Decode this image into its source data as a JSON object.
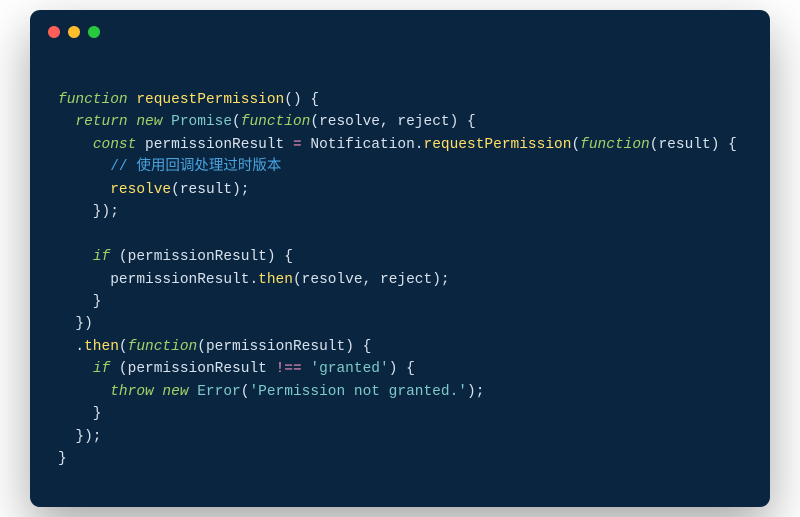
{
  "window": {
    "controls": [
      "close",
      "minimize",
      "zoom"
    ]
  },
  "code": {
    "tokens": [
      [
        {
          "t": "",
          "c": "pn"
        }
      ],
      [
        {
          "t": "function ",
          "c": "kw"
        },
        {
          "t": "requestPermission",
          "c": "fn"
        },
        {
          "t": "() {",
          "c": "pn"
        }
      ],
      [
        {
          "t": "  ",
          "c": "pn"
        },
        {
          "t": "return new ",
          "c": "kw"
        },
        {
          "t": "Promise",
          "c": "cls"
        },
        {
          "t": "(",
          "c": "pn"
        },
        {
          "t": "function",
          "c": "kw"
        },
        {
          "t": "(",
          "c": "pn"
        },
        {
          "t": "resolve",
          "c": "id"
        },
        {
          "t": ", ",
          "c": "pn"
        },
        {
          "t": "reject",
          "c": "id"
        },
        {
          "t": ") {",
          "c": "pn"
        }
      ],
      [
        {
          "t": "    ",
          "c": "pn"
        },
        {
          "t": "const ",
          "c": "kw"
        },
        {
          "t": "permissionResult",
          "c": "id"
        },
        {
          "t": " ",
          "c": "pn"
        },
        {
          "t": "=",
          "c": "op"
        },
        {
          "t": " Notification.",
          "c": "id"
        },
        {
          "t": "requestPermission",
          "c": "fn"
        },
        {
          "t": "(",
          "c": "pn"
        },
        {
          "t": "function",
          "c": "kw"
        },
        {
          "t": "(",
          "c": "pn"
        },
        {
          "t": "result",
          "c": "id"
        },
        {
          "t": ") {",
          "c": "pn"
        }
      ],
      [
        {
          "t": "      ",
          "c": "pn"
        },
        {
          "t": "// 使用回调处理过时版本",
          "c": "cmt"
        }
      ],
      [
        {
          "t": "      ",
          "c": "pn"
        },
        {
          "t": "resolve",
          "c": "fn"
        },
        {
          "t": "(",
          "c": "pn"
        },
        {
          "t": "result",
          "c": "id"
        },
        {
          "t": ");",
          "c": "pn"
        }
      ],
      [
        {
          "t": "    });",
          "c": "pn"
        }
      ],
      [
        {
          "t": "",
          "c": "pn"
        }
      ],
      [
        {
          "t": "    ",
          "c": "pn"
        },
        {
          "t": "if ",
          "c": "kw"
        },
        {
          "t": "(",
          "c": "pn"
        },
        {
          "t": "permissionResult",
          "c": "id"
        },
        {
          "t": ") {",
          "c": "pn"
        }
      ],
      [
        {
          "t": "      ",
          "c": "pn"
        },
        {
          "t": "permissionResult",
          "c": "id"
        },
        {
          "t": ".",
          "c": "pn"
        },
        {
          "t": "then",
          "c": "fn"
        },
        {
          "t": "(",
          "c": "pn"
        },
        {
          "t": "resolve",
          "c": "id"
        },
        {
          "t": ", ",
          "c": "pn"
        },
        {
          "t": "reject",
          "c": "id"
        },
        {
          "t": ");",
          "c": "pn"
        }
      ],
      [
        {
          "t": "    }",
          "c": "pn"
        }
      ],
      [
        {
          "t": "  })",
          "c": "pn"
        }
      ],
      [
        {
          "t": "  .",
          "c": "pn"
        },
        {
          "t": "then",
          "c": "fn"
        },
        {
          "t": "(",
          "c": "pn"
        },
        {
          "t": "function",
          "c": "kw"
        },
        {
          "t": "(",
          "c": "pn"
        },
        {
          "t": "permissionResult",
          "c": "id"
        },
        {
          "t": ") {",
          "c": "pn"
        }
      ],
      [
        {
          "t": "    ",
          "c": "pn"
        },
        {
          "t": "if ",
          "c": "kw"
        },
        {
          "t": "(",
          "c": "pn"
        },
        {
          "t": "permissionResult",
          "c": "id"
        },
        {
          "t": " ",
          "c": "pn"
        },
        {
          "t": "!==",
          "c": "op"
        },
        {
          "t": " ",
          "c": "pn"
        },
        {
          "t": "'granted'",
          "c": "str"
        },
        {
          "t": ") {",
          "c": "pn"
        }
      ],
      [
        {
          "t": "      ",
          "c": "pn"
        },
        {
          "t": "throw new ",
          "c": "kw"
        },
        {
          "t": "Error",
          "c": "cls"
        },
        {
          "t": "(",
          "c": "pn"
        },
        {
          "t": "'Permission not granted.'",
          "c": "str"
        },
        {
          "t": ");",
          "c": "pn"
        }
      ],
      [
        {
          "t": "    }",
          "c": "pn"
        }
      ],
      [
        {
          "t": "  });",
          "c": "pn"
        }
      ],
      [
        {
          "t": "}",
          "c": "pn"
        }
      ]
    ]
  }
}
